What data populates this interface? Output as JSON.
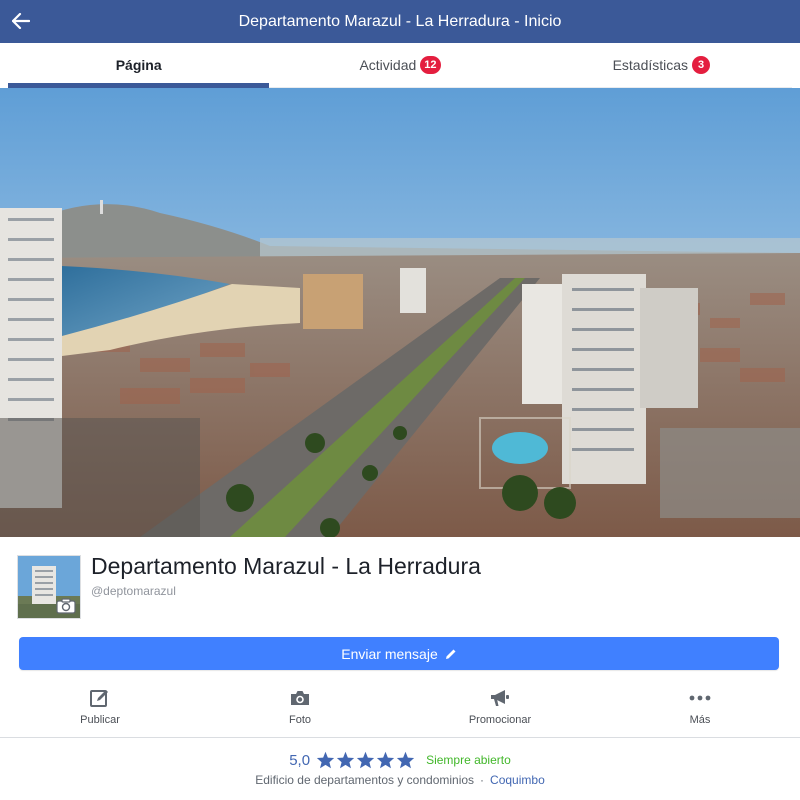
{
  "header": {
    "title": "Departamento Marazul - La Herradura - Inicio",
    "back_icon": "arrow-left-icon",
    "background_color": "#3b5998"
  },
  "tabs": [
    {
      "label": "Página",
      "active": true
    },
    {
      "label": "Actividad",
      "badge": "12"
    },
    {
      "label": "Estadísticas",
      "badge": "3"
    }
  ],
  "cover": {
    "icon": "cover-photo"
  },
  "page": {
    "name": "Departamento Marazul - La Herradura",
    "handle": "@deptomarazul",
    "profile_camera_icon": "camera-icon"
  },
  "message_button": {
    "label": "Enviar mensaje",
    "icon": "pencil-icon",
    "color": "#4080ff"
  },
  "actions": [
    {
      "label": "Publicar",
      "icon": "edit-icon"
    },
    {
      "label": "Foto",
      "icon": "camera-icon"
    },
    {
      "label": "Promocionar",
      "icon": "megaphone-icon"
    },
    {
      "label": "Más",
      "icon": "more-icon"
    }
  ],
  "info": {
    "rating": "5,0",
    "stars": 5,
    "open_status": "Siempre abierto",
    "category": "Edificio de departamentos y condominios",
    "separator": "·",
    "city": "Coquimbo"
  }
}
